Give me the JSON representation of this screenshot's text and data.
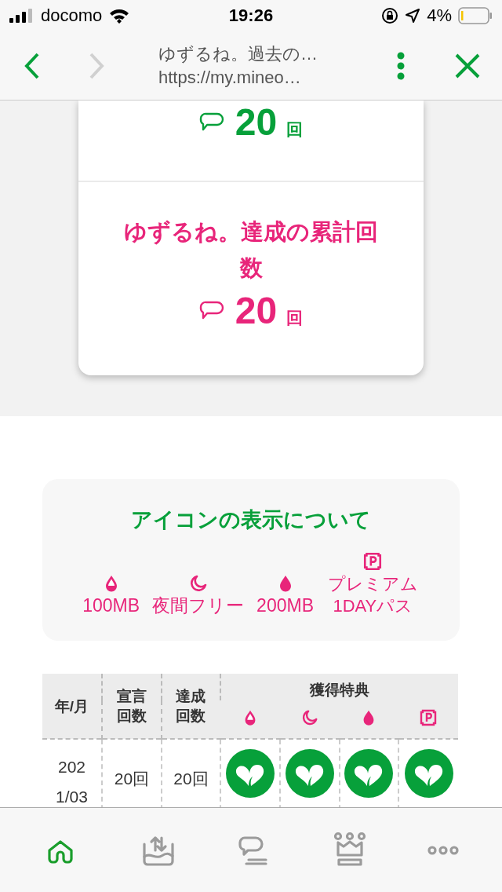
{
  "status_bar": {
    "carrier": "docomo",
    "time": "19:26",
    "battery": "4%"
  },
  "browser_bar": {
    "title": "ゆずるね。過去の…",
    "url": "https://my.mineo…",
    "back_enabled": true,
    "forward_enabled": false
  },
  "count_card": {
    "sections": [
      {
        "kind": "declared",
        "value": "20",
        "unit": "回"
      },
      {
        "kind": "achieved",
        "title": "ゆずるね。達成の累計回数",
        "value": "20",
        "unit": "回"
      }
    ]
  },
  "icon_legend": {
    "title": "アイコンの表示について",
    "items": [
      {
        "label": "100MB"
      },
      {
        "label": "夜間フリー"
      },
      {
        "label": "200MB"
      },
      {
        "label": "プレミアム1DAYパス"
      }
    ]
  },
  "history_table": {
    "columns": [
      "年/月",
      "宣言回数",
      "達成回数"
    ],
    "benefits_heading": "獲得特典",
    "rows": [
      {
        "month": "2021/03",
        "declared": "20回",
        "achieved": "20回",
        "benefits": [
          {
            "obtained": true
          },
          {
            "obtained": true
          },
          {
            "obtained": true
          },
          {
            "obtained": true
          }
        ]
      }
    ]
  },
  "tab_bar": {
    "items": [
      {
        "selected": true
      },
      {
        "selected": false
      },
      {
        "selected": false
      },
      {
        "selected": false
      },
      {
        "selected": false
      }
    ]
  }
}
